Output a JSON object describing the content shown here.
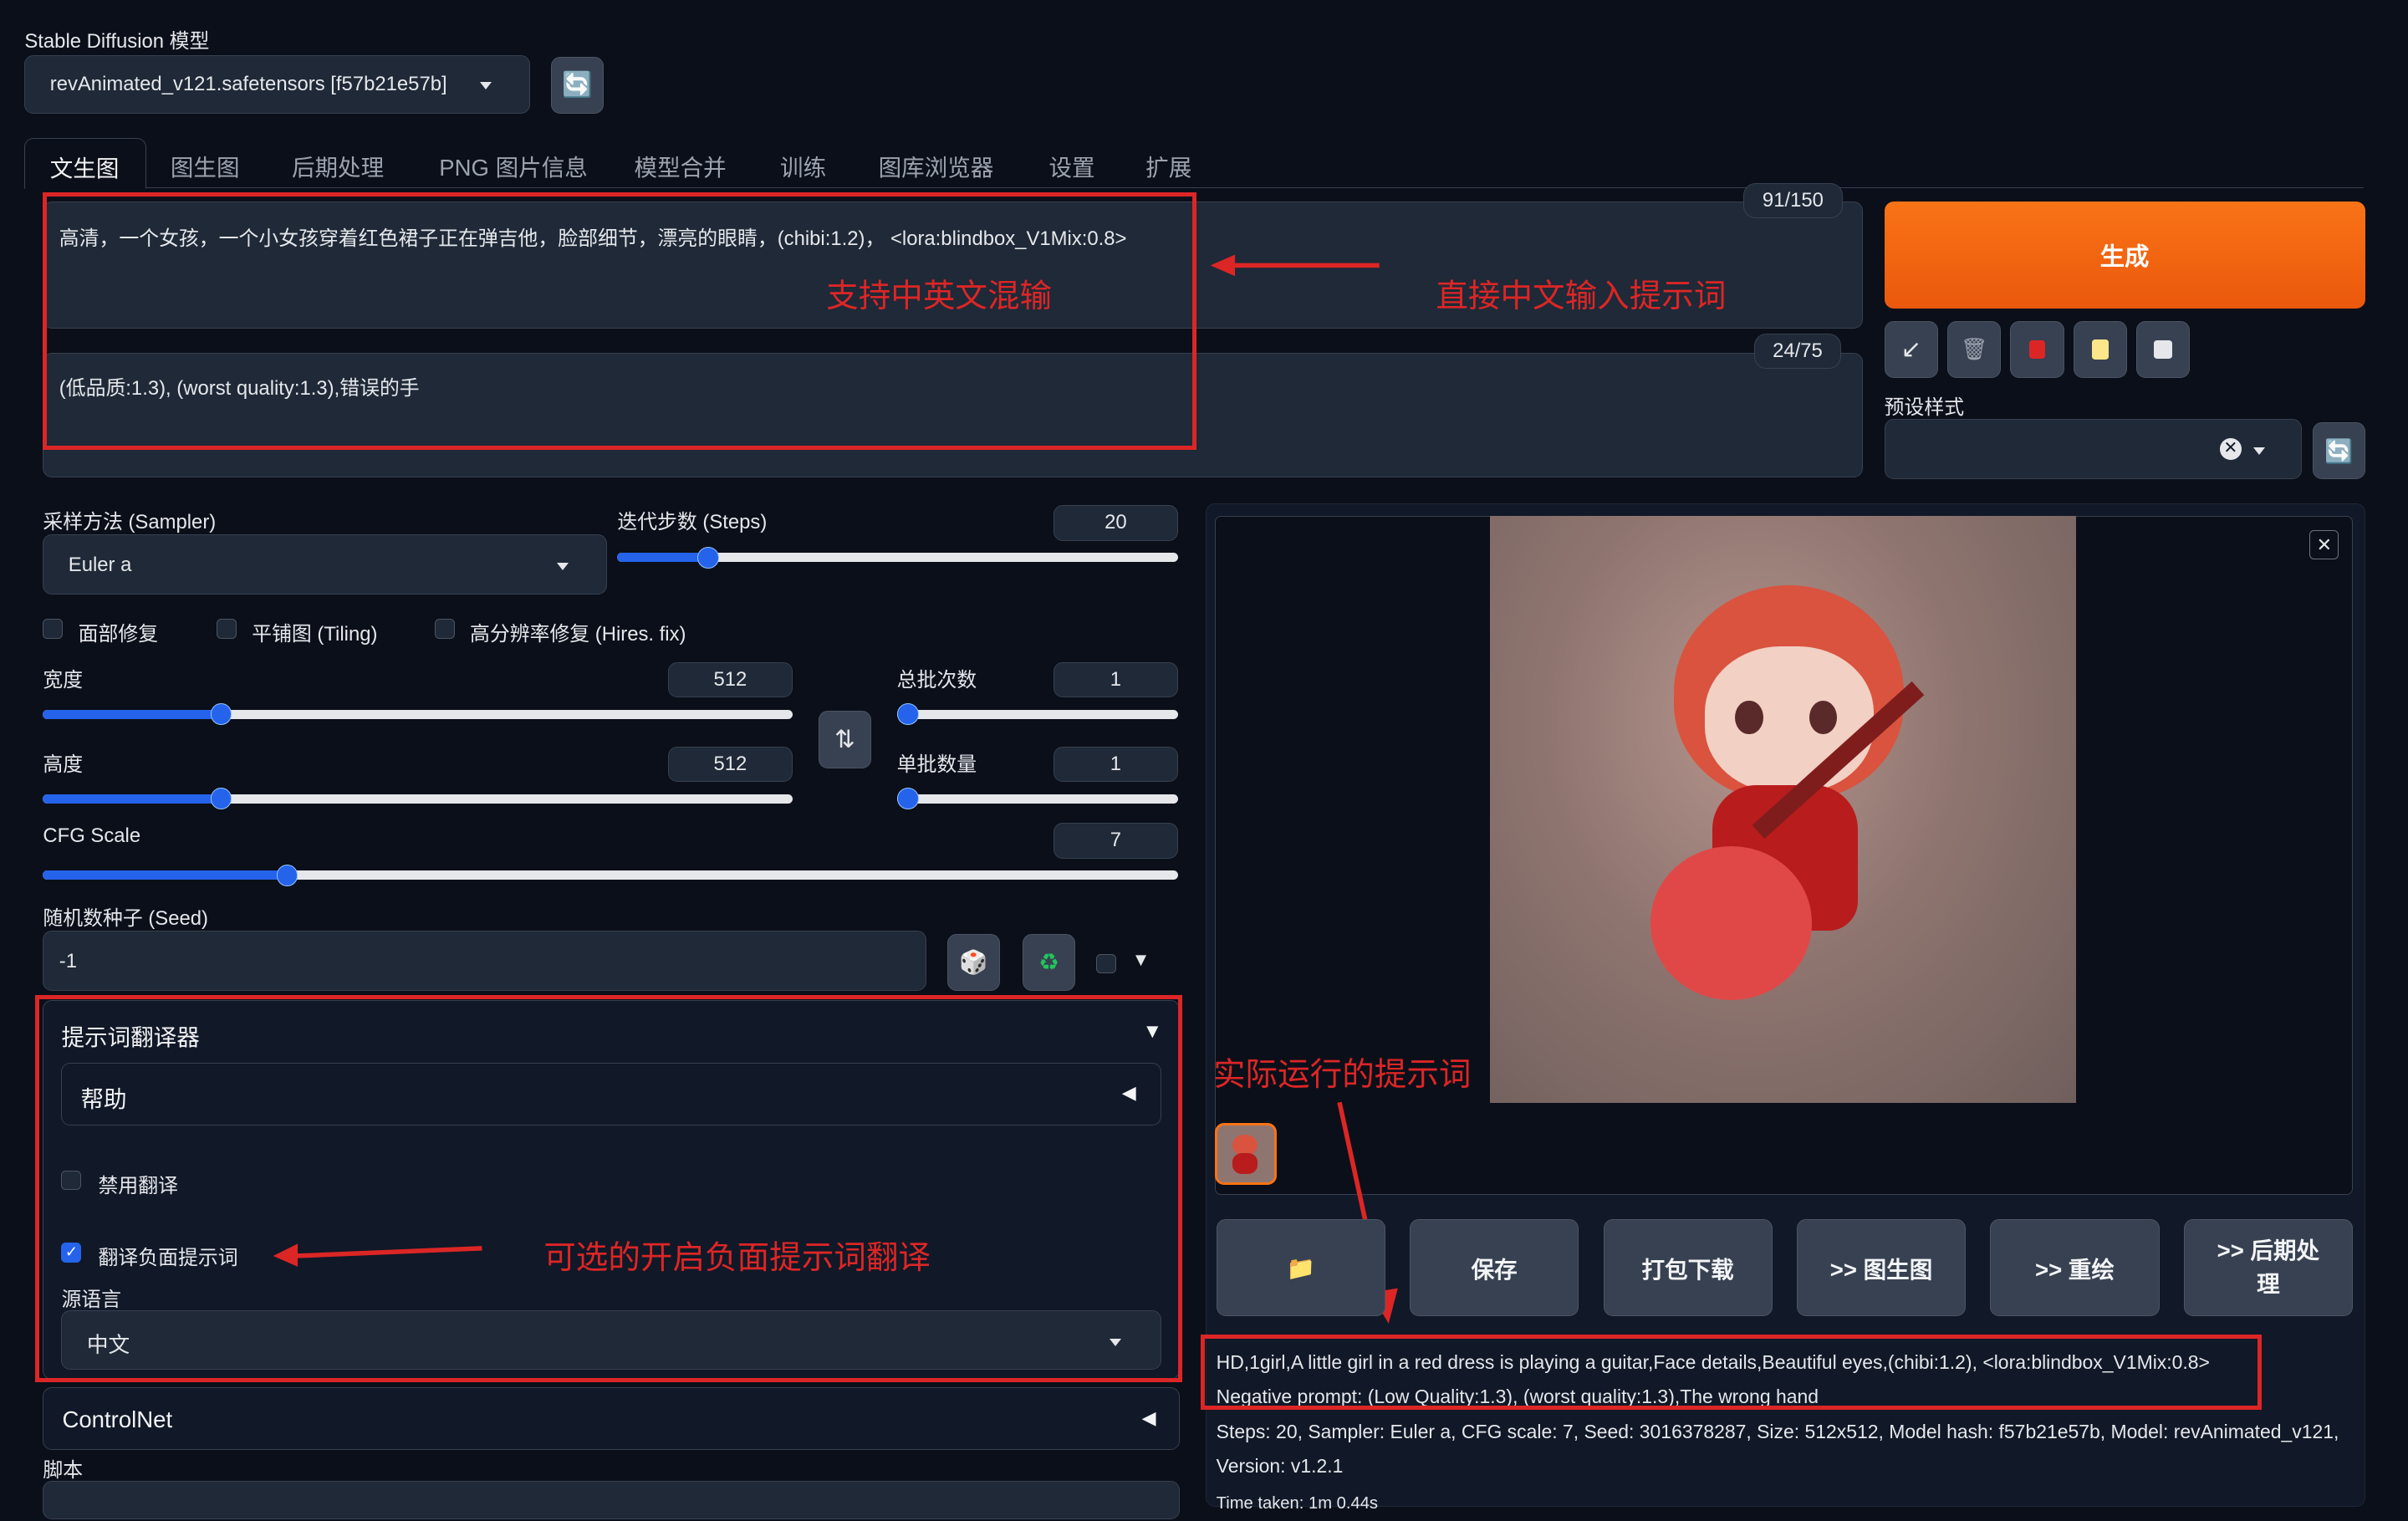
{
  "model": {
    "label": "Stable Diffusion 模型",
    "selected": "revAnimated_v121.safetensors [f57b21e57b]"
  },
  "tabs": [
    {
      "label": "文生图",
      "active": true
    },
    {
      "label": "图生图"
    },
    {
      "label": "后期处理"
    },
    {
      "label": "PNG 图片信息"
    },
    {
      "label": "模型合并"
    },
    {
      "label": "训练"
    },
    {
      "label": "图库浏览器"
    },
    {
      "label": "设置"
    },
    {
      "label": "扩展"
    }
  ],
  "prompt": {
    "value": "高清，一个女孩，一个小女孩穿着红色裙子正在弹吉他，脸部细节，漂亮的眼睛，(chibi:1.2)，  <lora:blindbox_V1Mix:0.8>",
    "counter": "91/150"
  },
  "negative_prompt": {
    "value": "(低品质:1.3), (worst quality:1.3),错误的手",
    "counter": "24/75"
  },
  "generate": {
    "label": "生成"
  },
  "tools": {
    "icons": [
      "arrow-in-icon",
      "trash-icon",
      "red-card-icon",
      "clipboard-icon",
      "save-icon"
    ]
  },
  "styles": {
    "label": "预设样式"
  },
  "sampler": {
    "label": "采样方法 (Sampler)",
    "value": "Euler a"
  },
  "steps": {
    "label": "迭代步数 (Steps)",
    "value": "20",
    "fraction": 0.16
  },
  "checkboxes": {
    "face": "面部修复",
    "tiling": "平铺图 (Tiling)",
    "hires": "高分辨率修复 (Hires. fix)"
  },
  "width": {
    "label": "宽度",
    "value": "512",
    "fraction": 0.235
  },
  "height": {
    "label": "高度",
    "value": "512",
    "fraction": 0.235
  },
  "batch_count": {
    "label": "总批次数",
    "value": "1",
    "fraction": 0.0
  },
  "batch_size": {
    "label": "单批数量",
    "value": "1",
    "fraction": 0.0
  },
  "cfg": {
    "label": "CFG Scale",
    "value": "7",
    "fraction": 0.214
  },
  "seed": {
    "label": "随机数种子 (Seed)",
    "value": "-1"
  },
  "translator": {
    "title": "提示词翻译器",
    "help": "帮助",
    "disable": "禁用翻译",
    "translate_negative": "翻译负面提示词",
    "translate_negative_checked": true,
    "source_lang_label": "源语言",
    "source_lang": "中文"
  },
  "controlnet": {
    "title": "ControlNet"
  },
  "script": {
    "label": "脚本"
  },
  "annotations": {
    "mixed": "支持中英文混输",
    "direct": "直接中文输入提示词",
    "actual": "实际运行的提示词",
    "optional": "可选的开启负面提示词翻译"
  },
  "output_buttons": [
    {
      "label": "📁",
      "name": "open-folder-button"
    },
    {
      "label": "保存",
      "name": "save-button"
    },
    {
      "label": "打包下载",
      "name": "zip-download-button"
    },
    {
      "label": ">> 图生图",
      "name": "send-img2img-button"
    },
    {
      "label": ">> 重绘",
      "name": "send-inpaint-button"
    },
    {
      "label": ">> 后期处理",
      "name": "send-extras-button"
    }
  ],
  "info": {
    "line1": "HD,1girl,A little girl in a red dress is playing a guitar,Face details,Beautiful eyes,(chibi:1.2), <lora:blindbox_V1Mix:0.8>",
    "line2": "Negative prompt: (Low Quality:1.3), (worst quality:1.3),The wrong hand",
    "line3": "Steps: 20, Sampler: Euler a, CFG scale: 7, Seed: 3016378287, Size: 512x512, Model hash: f57b21e57b, Model: revAnimated_v121,",
    "line4": "Version: v1.2.1",
    "time": "Time taken: 1m 0.44s"
  },
  "colors": {
    "accent": "#f97316",
    "annotation": "#dc2626",
    "slider": "#2563eb"
  }
}
